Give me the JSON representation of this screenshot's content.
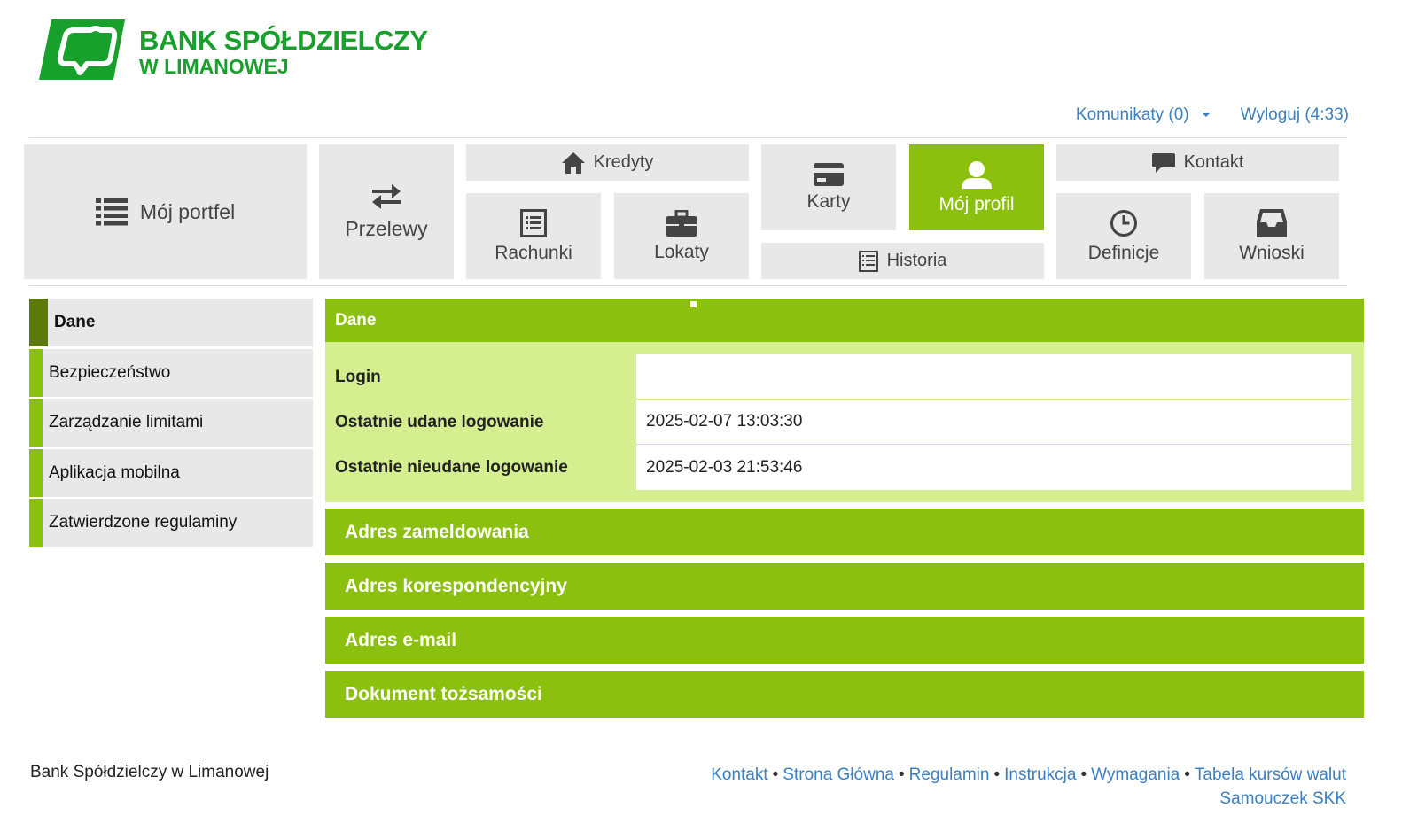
{
  "brand": {
    "line1": "BANK SPÓŁDZIELCZY",
    "line2": "W LIMANOWEJ",
    "color": "#18a02c"
  },
  "toplinks": {
    "messages": "Komunikaty (0)",
    "logout": "Wyloguj (4:33)"
  },
  "nav": {
    "portfolio": "Mój portfel",
    "transfers": "Przelewy",
    "credits": "Kredyty",
    "accounts": "Rachunki",
    "deposits": "Lokaty",
    "cards": "Karty",
    "profile": "Mój profil",
    "history": "Historia",
    "contact": "Kontakt",
    "definitions": "Definicje",
    "applications": "Wnioski"
  },
  "sidebar": {
    "items": [
      {
        "label": "Dane"
      },
      {
        "label": "Bezpieczeństwo"
      },
      {
        "label": "Zarządzanie limitami"
      },
      {
        "label": "Aplikacja mobilna"
      },
      {
        "label": "Zatwierdzone regulaminy"
      }
    ]
  },
  "panel": {
    "title": "Dane",
    "rows": [
      {
        "key": "Login",
        "value": ""
      },
      {
        "key": "Ostatnie udane logowanie",
        "value": "2025-02-07 13:03:30"
      },
      {
        "key": "Ostatnie nieudane logowanie",
        "value": "2025-02-03 21:53:46"
      }
    ]
  },
  "sections": [
    {
      "label": "Adres zameldowania"
    },
    {
      "label": "Adres korespondencyjny"
    },
    {
      "label": "Adres e-mail"
    },
    {
      "label": "Dokument tożsamości"
    }
  ],
  "footer": {
    "bank": "Bank Spółdzielczy w Limanowej",
    "links": [
      "Kontakt",
      "Strona Główna",
      "Regulamin",
      "Instrukcja",
      "Wymagania",
      "Tabela kursów walut"
    ],
    "tutorial": "Samouczek SKK"
  },
  "colors": {
    "accent": "#8cc00f",
    "accent_dark": "#5c7a08",
    "panel_bg": "#d5ee90",
    "link": "#3b7fc0",
    "tile_bg": "#e8e8e8"
  }
}
